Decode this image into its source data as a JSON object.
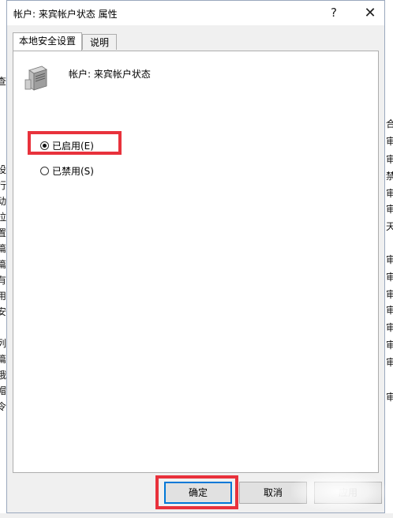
{
  "window": {
    "title": "帐户: 来宾帐户状态 属性",
    "help_glyph": "?",
    "close_glyph": "✕"
  },
  "tabs": [
    {
      "label": "本地安全设置"
    },
    {
      "label": "说明"
    }
  ],
  "policy": {
    "name": "帐户: 来宾帐户状态",
    "icon": "server-icon"
  },
  "options": [
    {
      "label": "已启用(E)",
      "checked": true
    },
    {
      "label": "已禁用(S)",
      "checked": false
    }
  ],
  "buttons": {
    "ok": "确定",
    "cancel": "取消",
    "apply": "应用"
  },
  "background_fragments": {
    "left": [
      "查",
      "设",
      "行",
      "动",
      "拉",
      "置",
      "篇",
      "篇",
      "有",
      "用",
      "安",
      "列",
      "篇",
      "哦",
      "帽",
      "令"
    ],
    "right": [
      "合",
      "审",
      "审",
      "禁",
      "审",
      "审",
      "天",
      "审",
      "审",
      "审",
      "审",
      "审",
      "审",
      "审",
      "审"
    ]
  },
  "colors": {
    "highlight": "#e8323c",
    "accent": "#0078d7"
  }
}
